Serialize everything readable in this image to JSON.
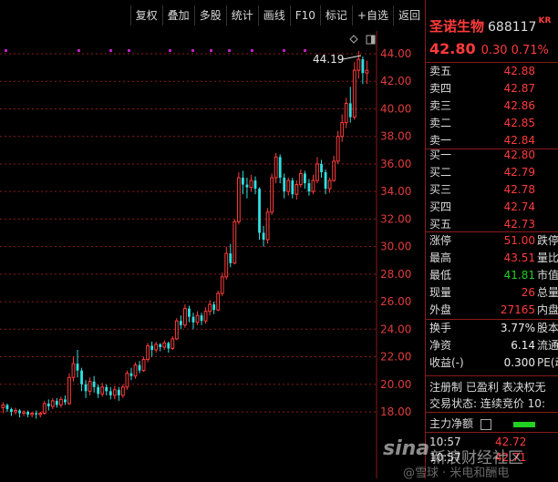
{
  "toolbar": {
    "buttons": [
      "复权",
      "叠加",
      "多股",
      "统计",
      "画线",
      "F10",
      "标记",
      "+自选",
      "返回"
    ]
  },
  "chart": {
    "max_label": "44.19",
    "y_ticks": [
      "44.00",
      "42.00",
      "40.00",
      "38.00",
      "36.00",
      "34.00",
      "32.00",
      "30.00",
      "28.00",
      "26.00",
      "24.00",
      "22.00",
      "20.00",
      "18.00"
    ]
  },
  "chart_data": {
    "type": "candlestick",
    "ylim": [
      16.8,
      45.3
    ],
    "y_ticks": [
      44,
      42,
      40,
      38,
      36,
      34,
      32,
      30,
      28,
      26,
      24,
      22,
      20,
      18
    ],
    "max_annotation": 44.19,
    "candles": [
      {
        "o": 18.3,
        "c": 18.5,
        "h": 18.7,
        "l": 17.9
      },
      {
        "o": 18.5,
        "c": 18.2,
        "h": 18.6,
        "l": 18.0
      },
      {
        "o": 18.2,
        "c": 18.0,
        "h": 18.3,
        "l": 17.7
      },
      {
        "o": 18.0,
        "c": 18.1,
        "h": 18.3,
        "l": 17.8
      },
      {
        "o": 18.1,
        "c": 17.9,
        "h": 18.2,
        "l": 17.6
      },
      {
        "o": 17.9,
        "c": 18.0,
        "h": 18.1,
        "l": 17.7
      },
      {
        "o": 18.0,
        "c": 17.8,
        "h": 18.1,
        "l": 17.6
      },
      {
        "o": 17.8,
        "c": 17.9,
        "h": 18.0,
        "l": 17.6
      },
      {
        "o": 17.9,
        "c": 17.8,
        "h": 18.1,
        "l": 17.5
      },
      {
        "o": 17.8,
        "c": 17.9,
        "h": 18.0,
        "l": 17.6
      },
      {
        "o": 17.9,
        "c": 18.6,
        "h": 18.8,
        "l": 17.8
      },
      {
        "o": 18.6,
        "c": 18.4,
        "h": 18.9,
        "l": 18.1
      },
      {
        "o": 18.4,
        "c": 18.8,
        "h": 19.0,
        "l": 18.2
      },
      {
        "o": 18.8,
        "c": 18.5,
        "h": 19.0,
        "l": 18.3
      },
      {
        "o": 18.5,
        "c": 18.9,
        "h": 19.1,
        "l": 18.3
      },
      {
        "o": 18.9,
        "c": 18.7,
        "h": 19.2,
        "l": 18.5
      },
      {
        "o": 18.6,
        "c": 20.5,
        "h": 20.8,
        "l": 18.5
      },
      {
        "o": 20.5,
        "c": 21.5,
        "h": 22.0,
        "l": 20.2
      },
      {
        "o": 21.5,
        "c": 21.0,
        "h": 22.5,
        "l": 20.5
      },
      {
        "o": 21.0,
        "c": 20.0,
        "h": 21.2,
        "l": 19.5
      },
      {
        "o": 20.0,
        "c": 19.5,
        "h": 20.3,
        "l": 19.0
      },
      {
        "o": 19.5,
        "c": 20.2,
        "h": 20.5,
        "l": 19.2
      },
      {
        "o": 20.2,
        "c": 19.8,
        "h": 20.6,
        "l": 19.4
      },
      {
        "o": 19.8,
        "c": 19.3,
        "h": 20.0,
        "l": 19.0
      },
      {
        "o": 19.3,
        "c": 19.8,
        "h": 20.1,
        "l": 19.1
      },
      {
        "o": 19.8,
        "c": 19.5,
        "h": 20.0,
        "l": 19.2
      },
      {
        "o": 19.5,
        "c": 19.2,
        "h": 19.8,
        "l": 18.9
      },
      {
        "o": 19.2,
        "c": 19.6,
        "h": 19.9,
        "l": 18.9
      },
      {
        "o": 19.6,
        "c": 19.2,
        "h": 19.8,
        "l": 18.8
      },
      {
        "o": 19.2,
        "c": 19.8,
        "h": 20.0,
        "l": 19.0
      },
      {
        "o": 19.8,
        "c": 20.8,
        "h": 21.0,
        "l": 19.6
      },
      {
        "o": 20.8,
        "c": 20.6,
        "h": 21.2,
        "l": 20.3
      },
      {
        "o": 20.6,
        "c": 21.4,
        "h": 21.6,
        "l": 20.4
      },
      {
        "o": 21.4,
        "c": 21.0,
        "h": 21.7,
        "l": 20.8
      },
      {
        "o": 21.0,
        "c": 21.8,
        "h": 22.0,
        "l": 20.9
      },
      {
        "o": 21.8,
        "c": 22.8,
        "h": 23.0,
        "l": 21.6
      },
      {
        "o": 22.8,
        "c": 22.5,
        "h": 23.1,
        "l": 22.0
      },
      {
        "o": 22.5,
        "c": 22.9,
        "h": 23.1,
        "l": 22.3
      },
      {
        "o": 22.9,
        "c": 22.7,
        "h": 23.0,
        "l": 22.4
      },
      {
        "o": 22.7,
        "c": 23.0,
        "h": 23.2,
        "l": 22.5
      },
      {
        "o": 23.0,
        "c": 22.6,
        "h": 23.1,
        "l": 22.3
      },
      {
        "o": 22.6,
        "c": 23.3,
        "h": 23.5,
        "l": 22.5
      },
      {
        "o": 23.3,
        "c": 24.6,
        "h": 24.8,
        "l": 23.2
      },
      {
        "o": 24.6,
        "c": 24.3,
        "h": 25.0,
        "l": 24.0
      },
      {
        "o": 24.3,
        "c": 25.5,
        "h": 25.8,
        "l": 24.1
      },
      {
        "o": 25.5,
        "c": 24.9,
        "h": 25.7,
        "l": 24.5
      },
      {
        "o": 24.9,
        "c": 24.5,
        "h": 25.2,
        "l": 24.0
      },
      {
        "o": 24.5,
        "c": 25.0,
        "h": 25.3,
        "l": 24.3
      },
      {
        "o": 25.0,
        "c": 24.6,
        "h": 25.2,
        "l": 24.3
      },
      {
        "o": 24.6,
        "c": 25.3,
        "h": 25.6,
        "l": 24.4
      },
      {
        "o": 25.3,
        "c": 25.8,
        "h": 26.1,
        "l": 25.0
      },
      {
        "o": 25.8,
        "c": 25.4,
        "h": 26.0,
        "l": 25.1
      },
      {
        "o": 25.4,
        "c": 26.6,
        "h": 26.8,
        "l": 25.3
      },
      {
        "o": 26.6,
        "c": 27.8,
        "h": 28.1,
        "l": 26.4
      },
      {
        "o": 27.8,
        "c": 29.5,
        "h": 30.0,
        "l": 27.6
      },
      {
        "o": 29.5,
        "c": 28.8,
        "h": 30.2,
        "l": 28.5
      },
      {
        "o": 28.8,
        "c": 31.8,
        "h": 32.0,
        "l": 28.7
      },
      {
        "o": 31.8,
        "c": 35.0,
        "h": 35.4,
        "l": 31.6
      },
      {
        "o": 35.0,
        "c": 34.5,
        "h": 35.5,
        "l": 33.8
      },
      {
        "o": 34.5,
        "c": 34.3,
        "h": 35.0,
        "l": 33.5
      },
      {
        "o": 34.3,
        "c": 34.8,
        "h": 35.2,
        "l": 34.0
      },
      {
        "o": 34.8,
        "c": 34.2,
        "h": 35.1,
        "l": 33.8
      },
      {
        "o": 34.2,
        "c": 31.0,
        "h": 34.3,
        "l": 30.5
      },
      {
        "o": 31.0,
        "c": 30.5,
        "h": 31.5,
        "l": 30.0
      },
      {
        "o": 30.5,
        "c": 32.5,
        "h": 32.8,
        "l": 30.2
      },
      {
        "o": 32.5,
        "c": 35.0,
        "h": 35.3,
        "l": 32.3
      },
      {
        "o": 35.0,
        "c": 36.5,
        "h": 36.8,
        "l": 34.6
      },
      {
        "o": 36.5,
        "c": 35.0,
        "h": 36.7,
        "l": 34.6
      },
      {
        "o": 35.0,
        "c": 34.0,
        "h": 35.3,
        "l": 33.5
      },
      {
        "o": 34.0,
        "c": 34.8,
        "h": 35.0,
        "l": 33.7
      },
      {
        "o": 34.8,
        "c": 33.8,
        "h": 35.0,
        "l": 33.5
      },
      {
        "o": 33.8,
        "c": 34.5,
        "h": 34.8,
        "l": 33.4
      },
      {
        "o": 34.5,
        "c": 35.3,
        "h": 35.6,
        "l": 34.3
      },
      {
        "o": 35.3,
        "c": 34.6,
        "h": 35.5,
        "l": 34.2
      },
      {
        "o": 34.6,
        "c": 34.0,
        "h": 34.9,
        "l": 33.7
      },
      {
        "o": 34.0,
        "c": 34.8,
        "h": 35.2,
        "l": 33.8
      },
      {
        "o": 34.8,
        "c": 36.0,
        "h": 36.5,
        "l": 34.6
      },
      {
        "o": 36.0,
        "c": 35.4,
        "h": 36.3,
        "l": 35.0
      },
      {
        "o": 35.4,
        "c": 34.2,
        "h": 35.6,
        "l": 33.8
      },
      {
        "o": 34.2,
        "c": 34.8,
        "h": 35.0,
        "l": 33.9
      },
      {
        "o": 34.8,
        "c": 36.2,
        "h": 36.6,
        "l": 34.7
      },
      {
        "o": 36.2,
        "c": 38.0,
        "h": 38.4,
        "l": 36.0
      },
      {
        "o": 38.0,
        "c": 39.0,
        "h": 39.6,
        "l": 37.6
      },
      {
        "o": 39.0,
        "c": 40.4,
        "h": 40.8,
        "l": 38.6
      },
      {
        "o": 40.4,
        "c": 39.4,
        "h": 41.6,
        "l": 39.0
      },
      {
        "o": 39.4,
        "c": 42.8,
        "h": 43.4,
        "l": 39.2
      },
      {
        "o": 42.8,
        "c": 43.6,
        "h": 44.19,
        "l": 42.2
      },
      {
        "o": 43.6,
        "c": 42.6,
        "h": 43.8,
        "l": 41.8
      },
      {
        "o": 42.6,
        "c": 42.8,
        "h": 43.51,
        "l": 41.81
      }
    ]
  },
  "panel": {
    "stock_name": "圣诺生物",
    "stock_code": "688117",
    "tag": "KR",
    "price": "42.80",
    "change": "0.30",
    "change_pct": "0.71%",
    "asks": [
      {
        "label": "卖五",
        "price": "42.88"
      },
      {
        "label": "卖四",
        "price": "42.87"
      },
      {
        "label": "卖三",
        "price": "42.86"
      },
      {
        "label": "卖二",
        "price": "42.85"
      },
      {
        "label": "卖一",
        "price": "42.84"
      }
    ],
    "bids": [
      {
        "label": "买一",
        "price": "42.80"
      },
      {
        "label": "买二",
        "price": "42.79"
      },
      {
        "label": "买三",
        "price": "42.78"
      },
      {
        "label": "买四",
        "price": "42.74"
      },
      {
        "label": "买五",
        "price": "42.73"
      }
    ],
    "stats": [
      {
        "l": "涨停",
        "v": "51.00",
        "vc": "red",
        "r": "跌停"
      },
      {
        "l": "最高",
        "v": "43.51",
        "vc": "red",
        "r": "量比"
      },
      {
        "l": "最低",
        "v": "41.81",
        "vc": "green",
        "r": "市值"
      },
      {
        "l": "现量",
        "v": "26",
        "vc": "red",
        "r": "总量"
      },
      {
        "l": "外盘",
        "v": "27165",
        "vc": "red",
        "r": "内盘"
      }
    ],
    "stats2": [
      {
        "l": "换手",
        "v": "3.77%",
        "vc": "white",
        "r": "股本"
      },
      {
        "l": "净资",
        "v": "6.14",
        "vc": "white",
        "r": "流通"
      },
      {
        "l": "收益(-)",
        "v": "0.300",
        "vc": "white",
        "r": "PE(动"
      }
    ],
    "tags_line": "注册制 已盈利 表决权无",
    "trade_status": "交易状态: 连续竞价 10:",
    "net_flow_label": "主力净额",
    "trades": [
      {
        "t": "10:57",
        "p": "42.72"
      },
      {
        "t": "10:57",
        "p": "42.71"
      }
    ]
  },
  "watermark": {
    "logo": "sina",
    "text": "新浪财经社区",
    "sub": "@雪球 · 米电和酬电"
  },
  "colors": {
    "up": "#ff3b3b",
    "down": "#2ee0e0",
    "grid": "#8b1a1a",
    "background": "#000000",
    "marker": "#c020c0"
  }
}
